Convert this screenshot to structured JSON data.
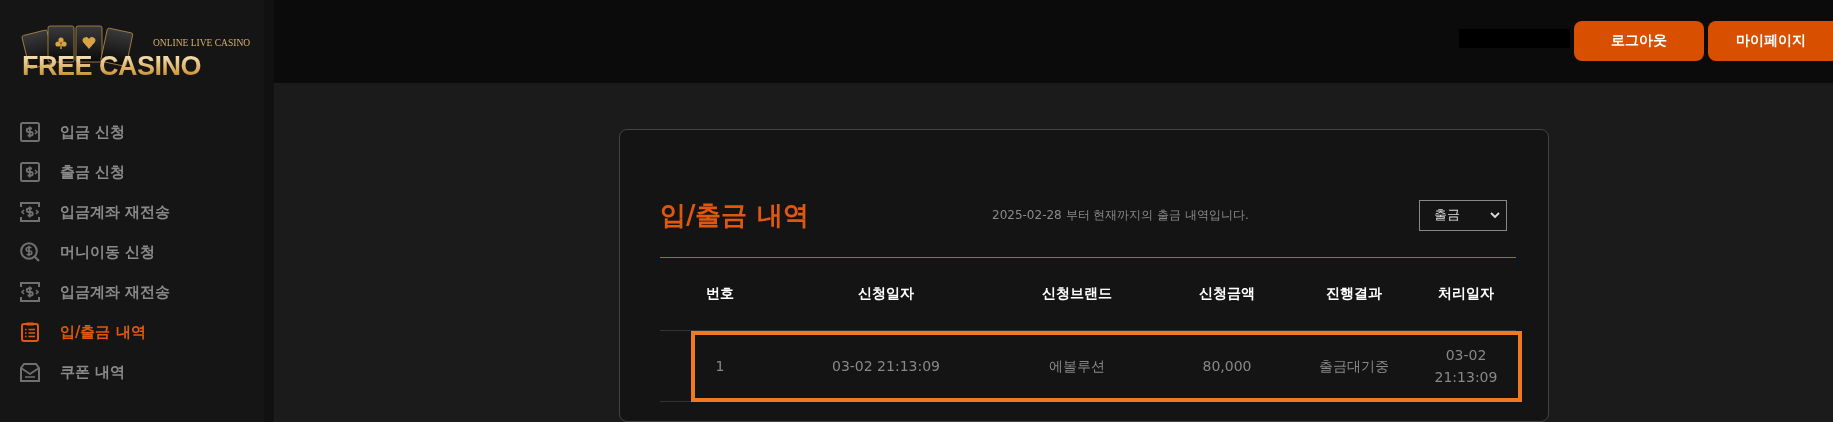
{
  "logo": {
    "tagline": "ONLINE LIVE CASINO",
    "name": "FREE CASINO"
  },
  "sidebar": {
    "items": [
      {
        "label": "입금 신청",
        "kind": "cash",
        "selected": false
      },
      {
        "label": "출금 신청",
        "kind": "cash",
        "selected": false
      },
      {
        "label": "입금계좌 재전송",
        "kind": "transfer",
        "selected": false
      },
      {
        "label": "머니이동 신청",
        "kind": "coin",
        "selected": false
      },
      {
        "label": "입금계좌 재전송",
        "kind": "transfer",
        "selected": false
      },
      {
        "label": "입/출금 내역",
        "kind": "list",
        "selected": true
      },
      {
        "label": "쿠폰 내역",
        "kind": "coupon",
        "selected": false
      }
    ]
  },
  "header": {
    "buttons": [
      "로그아웃",
      "마이페이지"
    ]
  },
  "card": {
    "title": "입/출금 내역",
    "subtitle": "2025-02-28 부터 현재까지의 출금 내역입니다.",
    "filter": {
      "value": "출금"
    },
    "table": {
      "columns": [
        "번호",
        "신청일자",
        "신청브랜드",
        "신청금액",
        "진행결과",
        "처리일자"
      ],
      "rows": [
        {
          "cells": [
            "1",
            "03-02 21:13:09",
            "에볼루션",
            "80,000",
            "출금대기중",
            "03-02\n21:13:09"
          ],
          "selected": true
        }
      ]
    }
  }
}
